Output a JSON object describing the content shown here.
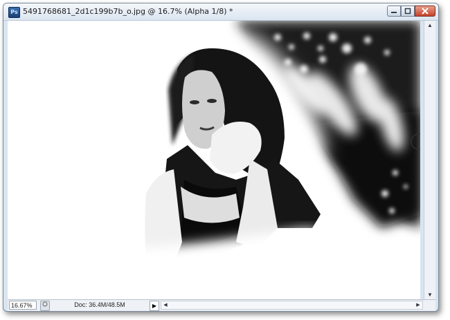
{
  "window": {
    "app_badge": "Ps",
    "title": "5491768681_2d1c199b7b_o.jpg @ 16.7% (Alpha 1/8) *",
    "buttons": {
      "minimize": "minimize",
      "maximize": "maximize",
      "close": "close"
    }
  },
  "statusbar": {
    "zoom": "16.67%",
    "doc_info": "Doc: 36.4M/48.5M",
    "arrow": "▶"
  },
  "scroll": {
    "up": "▲",
    "down": "▼",
    "left": "◀",
    "right": "▶"
  },
  "icons": {
    "app": "photoshop-icon",
    "brush_cursor": "brush-cursor-icon"
  }
}
